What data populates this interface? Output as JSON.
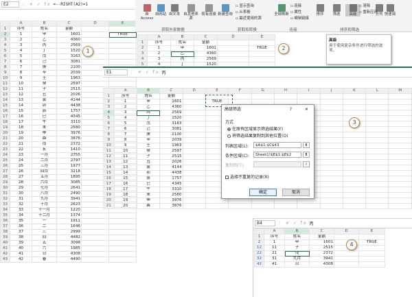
{
  "p1": {
    "namebox": "E2",
    "formula": "=--RIGHT(A2)=1",
    "cols": [
      "",
      "A",
      "B",
      "C",
      "D",
      "E"
    ],
    "rows": [
      [
        "1",
        "序号",
        "姓名",
        "金额",
        "",
        ""
      ],
      [
        "2",
        "1",
        "甲",
        "1601",
        "",
        "TRUE"
      ],
      [
        "3",
        "2",
        "乙",
        "4360",
        "",
        ""
      ],
      [
        "4",
        "3",
        "丙",
        "2569",
        "",
        ""
      ],
      [
        "5",
        "4",
        "丁",
        "1520",
        "",
        ""
      ],
      [
        "6",
        "5",
        "戊",
        "3163",
        "",
        ""
      ],
      [
        "7",
        "6",
        "己",
        "3081",
        "",
        ""
      ],
      [
        "8",
        "7",
        "庚",
        "2100",
        "",
        ""
      ],
      [
        "9",
        "8",
        "辛",
        "2039",
        "",
        ""
      ],
      [
        "10",
        "9",
        "壬",
        "1963",
        "",
        ""
      ],
      [
        "11",
        "10",
        "癸",
        "2597",
        "",
        ""
      ],
      [
        "12",
        "11",
        "子",
        "2515",
        "",
        ""
      ],
      [
        "13",
        "12",
        "丑",
        "2026",
        "",
        ""
      ],
      [
        "14",
        "13",
        "寅",
        "4144",
        "",
        ""
      ],
      [
        "15",
        "14",
        "卯",
        "4438",
        "",
        ""
      ],
      [
        "16",
        "15",
        "辰",
        "1757",
        "",
        ""
      ],
      [
        "17",
        "16",
        "巳",
        "4345",
        "",
        ""
      ],
      [
        "18",
        "17",
        "午",
        "3310",
        "",
        ""
      ],
      [
        "19",
        "18",
        "未",
        "2580",
        "",
        ""
      ],
      [
        "20",
        "19",
        "申",
        "3976",
        "",
        ""
      ],
      [
        "21",
        "20",
        "酉",
        "3876",
        "",
        ""
      ],
      [
        "22",
        "21",
        "戌",
        "2372",
        "",
        ""
      ],
      [
        "23",
        "22",
        "亥",
        "1410",
        "",
        ""
      ],
      [
        "24",
        "23",
        "一月",
        "2755",
        "",
        ""
      ],
      [
        "25",
        "24",
        "二月",
        "2797",
        "",
        ""
      ],
      [
        "26",
        "25",
        "三月",
        "1977",
        "",
        ""
      ],
      [
        "27",
        "26",
        "四月",
        "3218",
        "",
        ""
      ],
      [
        "28",
        "27",
        "五月",
        "1895",
        "",
        ""
      ],
      [
        "29",
        "28",
        "六月",
        "3085",
        "",
        ""
      ],
      [
        "30",
        "29",
        "七月",
        "2641",
        "",
        ""
      ],
      [
        "31",
        "30",
        "八月",
        "2490",
        "",
        ""
      ],
      [
        "32",
        "31",
        "九月",
        "3941",
        "",
        ""
      ],
      [
        "33",
        "32",
        "十月",
        "2623",
        "",
        ""
      ],
      [
        "34",
        "33",
        "十一月",
        "1220",
        "",
        ""
      ],
      [
        "35",
        "34",
        "十二月",
        "1374",
        "",
        ""
      ],
      [
        "36",
        "35",
        "一",
        "1911",
        "",
        ""
      ],
      [
        "37",
        "36",
        "二",
        "1646",
        "",
        ""
      ],
      [
        "38",
        "37",
        "三",
        "2999",
        "",
        ""
      ],
      [
        "39",
        "38",
        "四",
        "4482",
        "",
        ""
      ],
      [
        "40",
        "39",
        "五",
        "3098",
        "",
        ""
      ],
      [
        "41",
        "40",
        "六",
        "1985",
        "",
        ""
      ],
      [
        "42",
        "41",
        "日",
        "4308",
        "",
        ""
      ],
      [
        "43",
        "42",
        "春",
        "4490",
        "",
        ""
      ]
    ]
  },
  "p2": {
    "ribbon": [
      {
        "label": "自 Access",
        "color": "#a4373a"
      },
      {
        "label": "自网站",
        "color": "#2e75b6"
      },
      {
        "label": "自文本",
        "color": "#555"
      },
      {
        "label": "自其他来源",
        "color": "#777"
      },
      {
        "label": "现有连接",
        "color": "#777"
      },
      {
        "label": "新建查询",
        "color": "#2e75b6"
      },
      {
        "label": "全部刷新",
        "color": "#217346"
      },
      {
        "label": "排序",
        "color": "#555"
      },
      {
        "label": "筛选",
        "color": "#555"
      },
      {
        "label": "高级",
        "color": "#555"
      },
      {
        "label": "分列",
        "color": "#555"
      },
      {
        "label": "快速填",
        "color": "#555"
      }
    ],
    "smalls": [
      "显示查询",
      "从表格",
      "最近使用的源",
      "连接",
      "属性",
      "编辑链接",
      "清除",
      "重新应用"
    ],
    "groups": [
      "获取外部数据",
      "获取和转换",
      "连接",
      "排序和筛选"
    ],
    "tooltip_title": "高级",
    "tooltip_body": "用于使用复杂条件进行筛选的选项。",
    "cols": [
      "",
      "A",
      "B",
      "C",
      "D",
      "E"
    ],
    "rows": [
      [
        "1",
        "序号",
        "姓名",
        "金额",
        "",
        ""
      ],
      [
        "2",
        "1",
        "甲",
        "1601",
        "",
        "TRUE"
      ],
      [
        "3",
        "2",
        "乙",
        "4360",
        "",
        ""
      ],
      [
        "4",
        "3",
        "丙",
        "2569",
        "",
        ""
      ],
      [
        "5",
        "4",
        "丁",
        "1520",
        "",
        ""
      ]
    ]
  },
  "p3": {
    "namebox": "E1",
    "formula": "丙",
    "cols": [
      "",
      "A",
      "B",
      "C",
      "D",
      "E",
      "F",
      "G",
      "H",
      "I",
      "J",
      "K",
      "L",
      "M"
    ],
    "rows": [
      [
        "1",
        "序号",
        "姓名",
        "金额",
        "",
        "",
        ""
      ],
      [
        "2",
        "1",
        "甲",
        "1601",
        "",
        "TRUE",
        ""
      ],
      [
        "3",
        "2",
        "乙",
        "4360",
        "",
        "",
        ""
      ],
      [
        "4",
        "3",
        "丙",
        "2569",
        "",
        "",
        ""
      ],
      [
        "5",
        "4",
        "丁",
        "1520",
        "",
        "",
        ""
      ],
      [
        "6",
        "5",
        "戊",
        "3163",
        "",
        "",
        ""
      ],
      [
        "7",
        "6",
        "己",
        "3081",
        "",
        "",
        ""
      ],
      [
        "8",
        "7",
        "庚",
        "2100",
        "",
        "",
        ""
      ],
      [
        "9",
        "8",
        "辛",
        "2039",
        "",
        "",
        ""
      ],
      [
        "10",
        "9",
        "壬",
        "1963",
        "",
        "",
        ""
      ],
      [
        "11",
        "10",
        "癸",
        "2597",
        "",
        "",
        ""
      ],
      [
        "12",
        "11",
        "子",
        "2515",
        "",
        "",
        ""
      ],
      [
        "13",
        "12",
        "丑",
        "2026",
        "",
        "",
        ""
      ],
      [
        "14",
        "13",
        "寅",
        "4144",
        "",
        "",
        ""
      ],
      [
        "15",
        "14",
        "卯",
        "4438",
        "",
        "",
        ""
      ],
      [
        "16",
        "15",
        "辰",
        "1757",
        "",
        "",
        ""
      ],
      [
        "17",
        "16",
        "巳",
        "4345",
        "",
        "",
        ""
      ],
      [
        "18",
        "17",
        "午",
        "3310",
        "",
        "",
        ""
      ],
      [
        "19",
        "18",
        "未",
        "2580",
        "",
        "",
        ""
      ],
      [
        "20",
        "19",
        "申",
        "3976",
        "",
        "",
        ""
      ],
      [
        "21",
        "20",
        "酉",
        "3876",
        "",
        "",
        ""
      ]
    ]
  },
  "dialog": {
    "title": "高级筛选",
    "help": "?",
    "close": "✕",
    "method_label": "方式",
    "opt1": "在原有区域显示筛选结果(F)",
    "opt2": "将筛选结果复制到其他位置(O)",
    "list_label": "列表区域(L):",
    "list_value": "$A$1:$C$43",
    "crit_label": "条件区域(C):",
    "crit_value": "Sheet1!$E$1:$E$2",
    "copy_label": "复制到(T):",
    "copy_value": "",
    "unique_label": "选择不重复的记录(R)",
    "ok": "确定",
    "cancel": "取消"
  },
  "p4": {
    "namebox": "B4",
    "formula": "丙",
    "cols": [
      "",
      "A",
      "B",
      "C",
      "D",
      "E"
    ],
    "rows": [
      [
        "1",
        "序号",
        "姓名",
        "金额",
        "",
        ""
      ],
      [
        "2",
        "1",
        "甲",
        "1601",
        "",
        "TRUE"
      ],
      [
        "12",
        "11",
        "子",
        "2515",
        "",
        ""
      ],
      [
        "22",
        "21",
        "戌",
        "2372",
        "",
        ""
      ],
      [
        "32",
        "31",
        "九月",
        "3941",
        "",
        ""
      ],
      [
        "42",
        "41",
        "日",
        "4308",
        "",
        ""
      ]
    ]
  },
  "labels": {
    "c1": "1",
    "c2": "2",
    "c3": "3",
    "c4": "4"
  }
}
